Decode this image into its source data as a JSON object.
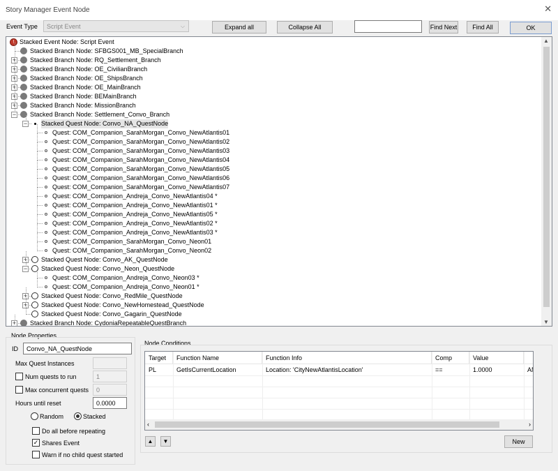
{
  "window": {
    "title": "Story Manager Event Node",
    "close_glyph": "✕"
  },
  "toolbar": {
    "event_type_label": "Event Type",
    "event_type_value": "Script Event",
    "expand_all": "Expand all",
    "collapse_all": "Collapse All",
    "find_text": "",
    "find_next": "Find Next",
    "find_all": "Find All",
    "ok": "OK"
  },
  "tree": {
    "rows": [
      {
        "text": "Stacked Event Node: Script Event",
        "icon": "stop-icon"
      },
      {
        "text": "Stacked Branch Node: SFBGS001_MB_SpecialBranch",
        "icon": "branch-icon"
      },
      {
        "text": "Stacked Branch Node: RQ_Settlement_Branch",
        "icon": "branch-icon",
        "expander": "+"
      },
      {
        "text": "Stacked Branch Node: OE_CivilianBranch",
        "icon": "branch-icon",
        "expander": "+"
      },
      {
        "text": "Stacked Branch Node: OE_ShipsBranch",
        "icon": "branch-icon",
        "expander": "+"
      },
      {
        "text": "Stacked Branch Node: OE_MainBranch",
        "icon": "branch-icon",
        "expander": "+"
      },
      {
        "text": "Stacked Branch Node: BEMainBranch",
        "icon": "branch-icon",
        "expander": "+"
      },
      {
        "text": "Stacked Branch Node: MissionBranch",
        "icon": "branch-icon",
        "expander": "+"
      },
      {
        "text": "Stacked Branch Node: Settlement_Convo_Branch",
        "icon": "branch-icon",
        "expander": "−"
      },
      {
        "text": "Stacked Quest Node: Convo_NA_QuestNode",
        "icon": "quest-node-selected-icon",
        "expander": "−"
      },
      {
        "text": "Quest: COM_Companion_SarahMorgan_Convo_NewAtlantis01",
        "icon": "quest-icon"
      },
      {
        "text": "Quest: COM_Companion_SarahMorgan_Convo_NewAtlantis02",
        "icon": "quest-icon"
      },
      {
        "text": "Quest: COM_Companion_SarahMorgan_Convo_NewAtlantis03",
        "icon": "quest-icon"
      },
      {
        "text": "Quest: COM_Companion_SarahMorgan_Convo_NewAtlantis04",
        "icon": "quest-icon"
      },
      {
        "text": "Quest: COM_Companion_SarahMorgan_Convo_NewAtlantis05",
        "icon": "quest-icon"
      },
      {
        "text": "Quest: COM_Companion_SarahMorgan_Convo_NewAtlantis06",
        "icon": "quest-icon"
      },
      {
        "text": "Quest: COM_Companion_SarahMorgan_Convo_NewAtlantis07",
        "icon": "quest-icon"
      },
      {
        "text": "Quest: COM_Companion_Andreja_Convo_NewAtlantis04 *",
        "icon": "quest-icon"
      },
      {
        "text": "Quest: COM_Companion_Andreja_Convo_NewAtlantis01 *",
        "icon": "quest-icon"
      },
      {
        "text": "Quest: COM_Companion_Andreja_Convo_NewAtlantis05 *",
        "icon": "quest-icon"
      },
      {
        "text": "Quest: COM_Companion_Andreja_Convo_NewAtlantis02 *",
        "icon": "quest-icon"
      },
      {
        "text": "Quest: COM_Companion_Andreja_Convo_NewAtlantis03 *",
        "icon": "quest-icon"
      },
      {
        "text": "Quest: COM_Companion_SarahMorgan_Convo_Neon01",
        "icon": "quest-icon"
      },
      {
        "text": "Quest: COM_Companion_SarahMorgan_Convo_Neon02",
        "icon": "quest-icon"
      },
      {
        "text": "Stacked Quest Node: Convo_AK_QuestNode",
        "icon": "quest-node-icon",
        "expander": "+"
      },
      {
        "text": "Stacked Quest Node: Convo_Neon_QuestNode",
        "icon": "quest-node-icon",
        "expander": "−"
      },
      {
        "text": "Quest: COM_Companion_Andreja_Convo_Neon03 *",
        "icon": "quest-icon"
      },
      {
        "text": "Quest: COM_Companion_Andreja_Convo_Neon01 *",
        "icon": "quest-icon"
      },
      {
        "text": "Stacked Quest Node: Convo_RedMile_QuestNode",
        "icon": "quest-node-icon",
        "expander": "+"
      },
      {
        "text": "Stacked Quest Node: Convo_NewHomestead_QuestNode",
        "icon": "quest-node-icon",
        "expander": "+"
      },
      {
        "text": "Stacked Quest Node: Convo_Gagarin_QuestNode",
        "icon": "quest-node-icon"
      },
      {
        "text": "Stacked Branch Node: CydoniaRepeatableQuestBranch",
        "icon": "branch-icon",
        "expander": "+"
      }
    ]
  },
  "node_properties": {
    "group_label": "Node Properties",
    "id_label": "ID",
    "id_value": "Convo_NA_QuestNode",
    "max_quest_instances_label": "Max Quest Instances",
    "max_quest_instances_value": "",
    "num_quests_label": "Num quests to run",
    "num_quests_value": "1",
    "max_concurrent_label": "Max concurrent quests",
    "max_concurrent_value": "0",
    "hours_reset_label": "Hours until reset",
    "hours_reset_value": "0.0000",
    "random_label": "Random",
    "stacked_label": "Stacked",
    "do_all_label": "Do all before repeating",
    "shares_event_label": "Shares Event",
    "warn_label": "Warn if no child quest started",
    "check_glyph": "✓"
  },
  "node_conditions": {
    "group_label": "Node Conditions",
    "columns": [
      "Target",
      "Function Name",
      "Function Info",
      "Comp",
      "Value",
      "AND"
    ],
    "row": {
      "target": "PL",
      "function_name": "GetIsCurrentLocation",
      "function_info": "Location: 'CityNewAtlantisLocation'",
      "comp": "==",
      "value": "1.0000",
      "and": "AN"
    },
    "new_button": "New",
    "up_glyph": "▲",
    "down_glyph": "▼"
  }
}
